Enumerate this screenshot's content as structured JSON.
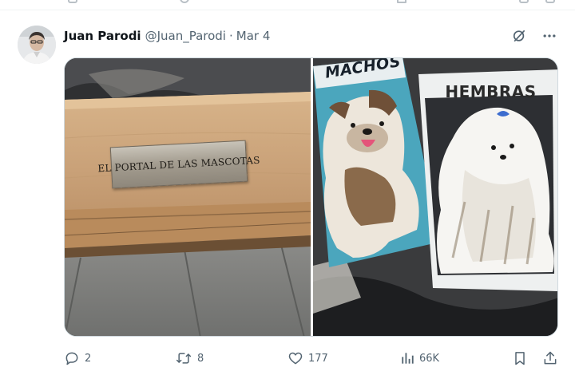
{
  "tweet": {
    "author_name": "Juan Parodi",
    "author_handle": "@Juan_Parodi",
    "separator": "·",
    "date": "Mar 4",
    "grok_icon": "grok-icon",
    "more_icon": "more-icon",
    "media": {
      "left_photo": {
        "plaque_text": "EL PORTAL DE LAS MASCOTAS"
      },
      "right_photo": {
        "sign_left": "MACHOS",
        "sign_right": "HEMBRAS"
      }
    },
    "actions": {
      "replies": "2",
      "reposts": "8",
      "likes": "177",
      "views": "66K"
    }
  },
  "colors": {
    "text_primary": "#0f1419",
    "text_secondary": "#536471",
    "border": "#cfd9de"
  }
}
